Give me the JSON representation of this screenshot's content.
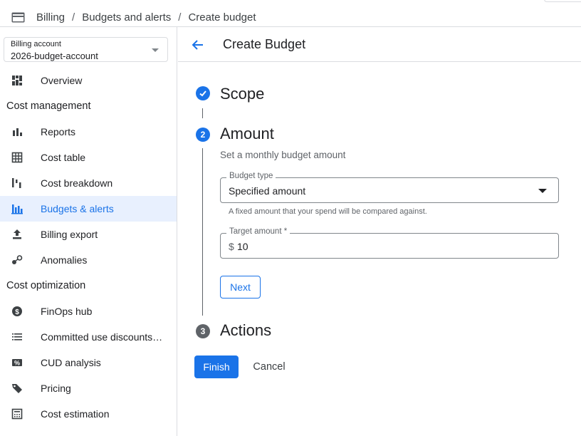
{
  "breadcrumb": {
    "icon": "billing-card-icon",
    "items": [
      "Billing",
      "Budgets and alerts",
      "Create budget"
    ],
    "separator": "/"
  },
  "sidebar": {
    "account_select": {
      "label": "Billing account",
      "value": "2026-budget-account"
    },
    "overview": {
      "label": "Overview",
      "icon": "overview-grid-icon"
    },
    "sections": [
      {
        "title": "Cost management",
        "items": [
          {
            "label": "Reports",
            "icon": "bar-chart-icon"
          },
          {
            "label": "Cost table",
            "icon": "table-icon"
          },
          {
            "label": "Cost breakdown",
            "icon": "waterfall-icon"
          },
          {
            "label": "Budgets & alerts",
            "icon": "budget-icon",
            "active": true
          },
          {
            "label": "Billing export",
            "icon": "upload-icon"
          },
          {
            "label": "Anomalies",
            "icon": "anomalies-icon"
          }
        ]
      },
      {
        "title": "Cost optimization",
        "items": [
          {
            "label": "FinOps hub",
            "icon": "dollar-circle-icon"
          },
          {
            "label": "Committed use discounts…",
            "icon": "list-icon"
          },
          {
            "label": "CUD analysis",
            "icon": "percent-icon"
          },
          {
            "label": "Pricing",
            "icon": "tag-icon"
          },
          {
            "label": "Cost estimation",
            "icon": "calculator-icon"
          }
        ]
      }
    ]
  },
  "main": {
    "title": "Create Budget",
    "steps": [
      {
        "number": "1",
        "title": "Scope",
        "state": "complete"
      },
      {
        "number": "2",
        "title": "Amount",
        "state": "active"
      },
      {
        "number": "3",
        "title": "Actions",
        "state": "pending"
      }
    ],
    "amount": {
      "description": "Set a monthly budget amount",
      "budget_type": {
        "label": "Budget type",
        "value": "Specified amount",
        "helper": "A fixed amount that your spend will be compared against."
      },
      "target_amount": {
        "label": "Target amount *",
        "prefix": "$",
        "value": "10"
      },
      "next_label": "Next"
    },
    "finish_label": "Finish",
    "cancel_label": "Cancel"
  },
  "colors": {
    "accent": "#1a73e8",
    "active_bg": "#e8f0fe",
    "step_pending": "#5f6368"
  }
}
